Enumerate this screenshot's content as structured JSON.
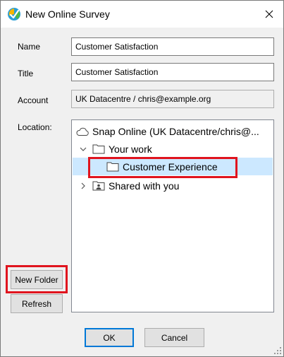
{
  "window": {
    "title": "New Online Survey"
  },
  "form": {
    "name_label": "Name",
    "name_value": "Customer Satisfaction",
    "title_label": "Title",
    "title_value": "Customer Satisfaction",
    "account_label": "Account",
    "account_value": "UK Datacentre / chris@example.org",
    "location_label": "Location:"
  },
  "tree": {
    "root_label": "Snap Online (UK Datacentre/chris@...",
    "your_work_label": "Your work",
    "selected_folder_label": "Customer Experience",
    "shared_label": "Shared with you"
  },
  "buttons": {
    "new_folder": "New Folder",
    "refresh": "Refresh",
    "ok": "OK",
    "cancel": "Cancel"
  },
  "colors": {
    "highlight": "#e0141e",
    "selection": "#cce8ff",
    "default_button_border": "#0078d7"
  },
  "icons": {
    "app": "snap-survey-icon",
    "close": "close-icon",
    "cloud": "cloud-icon",
    "folder": "folder-icon",
    "shared_folder": "shared-folder-icon",
    "expanded": "chevron-down-icon",
    "collapsed": "chevron-right-icon"
  }
}
